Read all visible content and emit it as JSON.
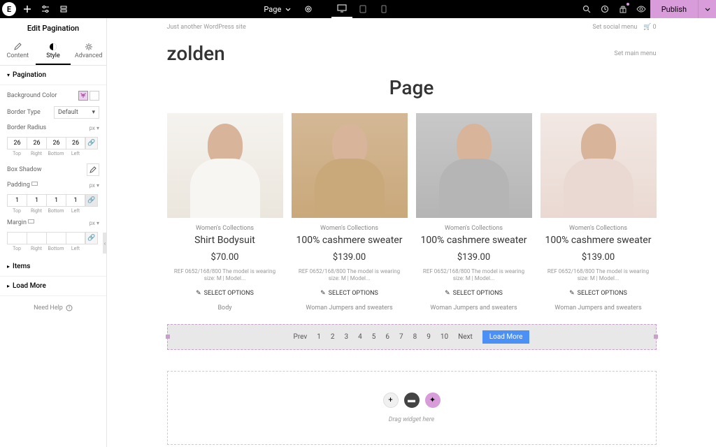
{
  "topbar": {
    "page_label": "Page",
    "publish_label": "Publish"
  },
  "sidebar": {
    "title": "Edit Pagination",
    "tabs": {
      "content": "Content",
      "style": "Style",
      "advanced": "Advanced"
    },
    "sections": {
      "pagination": {
        "title": "Pagination",
        "bg_color_label": "Background Color",
        "border_type_label": "Border Type",
        "border_type_value": "Default",
        "border_radius_label": "Border Radius",
        "border_radius_unit": "px",
        "border_radius_values": [
          "26",
          "26",
          "26",
          "26"
        ],
        "box_shadow_label": "Box Shadow",
        "padding_label": "Padding",
        "padding_unit": "px",
        "padding_values": [
          "1",
          "1",
          "1",
          "1"
        ],
        "margin_label": "Margin",
        "margin_unit": "px",
        "margin_values": [
          "",
          "",
          "",
          ""
        ],
        "side_labels": [
          "Top",
          "Right",
          "Bottom",
          "Left"
        ]
      },
      "items": "Items",
      "loadmore": "Load More"
    },
    "need_help": "Need Help"
  },
  "canvas": {
    "tagline": "Just another WordPress site",
    "social_menu": "Set social menu",
    "cart_count": "0",
    "brand": "zolden",
    "set_main_menu": "Set main menu",
    "page_title": "Page",
    "products": [
      {
        "cat": "Women's Collections",
        "title": "Shirt Bodysuit",
        "price": "$70.00",
        "desc": "REF 0652/168/800 The model is wearing size: M | Model...",
        "opts": "SELECT OPTIONS",
        "tag": "Body"
      },
      {
        "cat": "Women's Collections",
        "title": "100% cashmere sweater",
        "price": "$139.00",
        "desc": "REF 0652/168/800 The model is wearing size: M | Model...",
        "opts": "SELECT OPTIONS",
        "tag": "Woman Jumpers and sweaters"
      },
      {
        "cat": "Women's Collections",
        "title": "100% cashmere sweater",
        "price": "$139.00",
        "desc": "REF 0652/168/800 The model is wearing size: M | Model...",
        "opts": "SELECT OPTIONS",
        "tag": "Woman Jumpers and sweaters"
      },
      {
        "cat": "Women's Collections",
        "title": "100% cashmere sweater",
        "price": "$139.00",
        "desc": "REF 0652/168/800 The model is wearing size: M | Model...",
        "opts": "SELECT OPTIONS",
        "tag": "Woman Jumpers and sweaters"
      }
    ],
    "pagination": {
      "prev": "Prev",
      "pages": [
        "1",
        "2",
        "3",
        "4",
        "5",
        "6",
        "7",
        "8",
        "9",
        "10"
      ],
      "next": "Next",
      "load_more": "Load More"
    },
    "drop_text": "Drag widget here"
  }
}
